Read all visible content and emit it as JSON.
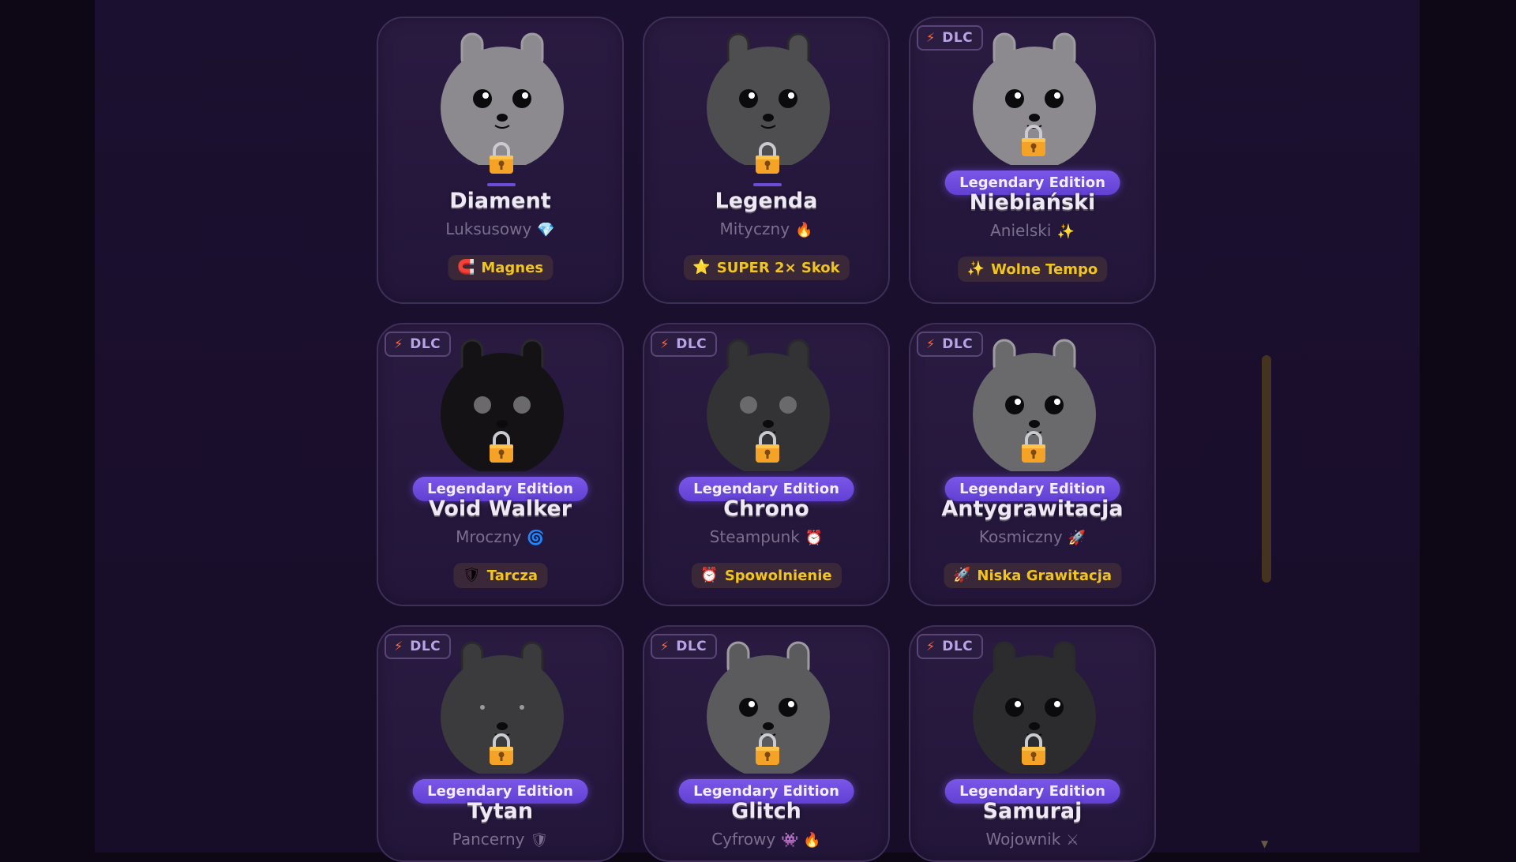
{
  "dlc_badge": {
    "label": "DLC",
    "icon": "lightning-icon"
  },
  "legendary_label": "Legendary Edition",
  "colors": {
    "ability_text": "#f2c51c",
    "legendary_badge": "#6f4de0",
    "dlc_bolt": "#ff6a3d"
  },
  "cards": [
    {
      "name": "Diament",
      "rarity": "Luksusowy",
      "rarity_icon": "💎",
      "ability_icon": "🧲",
      "ability": "Magnes",
      "dlc": false,
      "legendary": false,
      "bunny_color": "#8c8a8e",
      "eyes": "normal"
    },
    {
      "name": "Legenda",
      "rarity": "Mityczny",
      "rarity_icon": "🔥",
      "ability_icon": "⭐",
      "ability": "SUPER 2× Skok",
      "dlc": false,
      "legendary": false,
      "bunny_color": "#4e4d50",
      "eyes": "normal"
    },
    {
      "name": "Niebiański",
      "rarity": "Anielski",
      "rarity_icon": "✨",
      "ability_icon": "✨",
      "ability": "Wolne Tempo",
      "dlc": true,
      "legendary": true,
      "bunny_color": "#8c8a8e",
      "eyes": "normal"
    },
    {
      "name": "Void Walker",
      "rarity": "Mroczny",
      "rarity_icon": "🌀",
      "ability_icon": "🛡",
      "ability": "Tarcza",
      "dlc": true,
      "legendary": true,
      "bunny_color": "#141215",
      "eyes": "grey"
    },
    {
      "name": "Chrono",
      "rarity": "Steampunk",
      "rarity_icon": "⏰",
      "ability_icon": "⏰",
      "ability": "Spowolnienie",
      "dlc": true,
      "legendary": true,
      "bunny_color": "#333234",
      "eyes": "grey"
    },
    {
      "name": "Antygrawitacja",
      "rarity": "Kosmiczny",
      "rarity_icon": "🚀",
      "ability_icon": "🚀",
      "ability": "Niska Grawitacja",
      "dlc": true,
      "legendary": true,
      "bunny_color": "#6a696c",
      "eyes": "normal"
    },
    {
      "name": "Tytan",
      "rarity": "Pancerny",
      "rarity_icon": "🛡",
      "ability_icon": "",
      "ability": "",
      "dlc": true,
      "legendary": true,
      "bunny_color": "#3b3a3d",
      "eyes": "tiny"
    },
    {
      "name": "Glitch",
      "rarity": "Cyfrowy",
      "rarity_icon": "👾 🔥",
      "ability_icon": "",
      "ability": "",
      "dlc": true,
      "legendary": true,
      "bunny_color": "#5b5a5d",
      "eyes": "normal"
    },
    {
      "name": "Samuraj",
      "rarity": "Wojownik",
      "rarity_icon": "⚔",
      "ability_icon": "",
      "ability": "",
      "dlc": true,
      "legendary": true,
      "bunny_color": "#2c2b2d",
      "eyes": "normal"
    }
  ]
}
